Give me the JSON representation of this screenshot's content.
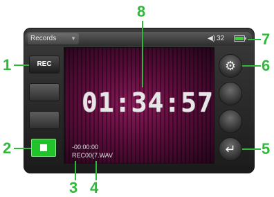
{
  "header": {
    "dropdown_label": "Records",
    "volume_value": "32",
    "battery_level": 1.0
  },
  "left_panel": {
    "rec_label": "REC"
  },
  "display": {
    "clock": "01:34:57",
    "elapsed": "-00:00:00",
    "filename": "REC00(7.WAV"
  },
  "callouts": [
    "1",
    "2",
    "3",
    "4",
    "5",
    "6",
    "7",
    "8"
  ],
  "colors": {
    "callout": "#2fb83a",
    "stop_button": "#22c22c",
    "battery_fill": "#3fcf3f",
    "display_bg": "#5a0c3a"
  },
  "icons": {
    "speaker": "speaker-icon",
    "battery": "battery-icon",
    "stop": "stop-icon",
    "settings": "gear-icon",
    "back": "return-arrow-icon"
  }
}
